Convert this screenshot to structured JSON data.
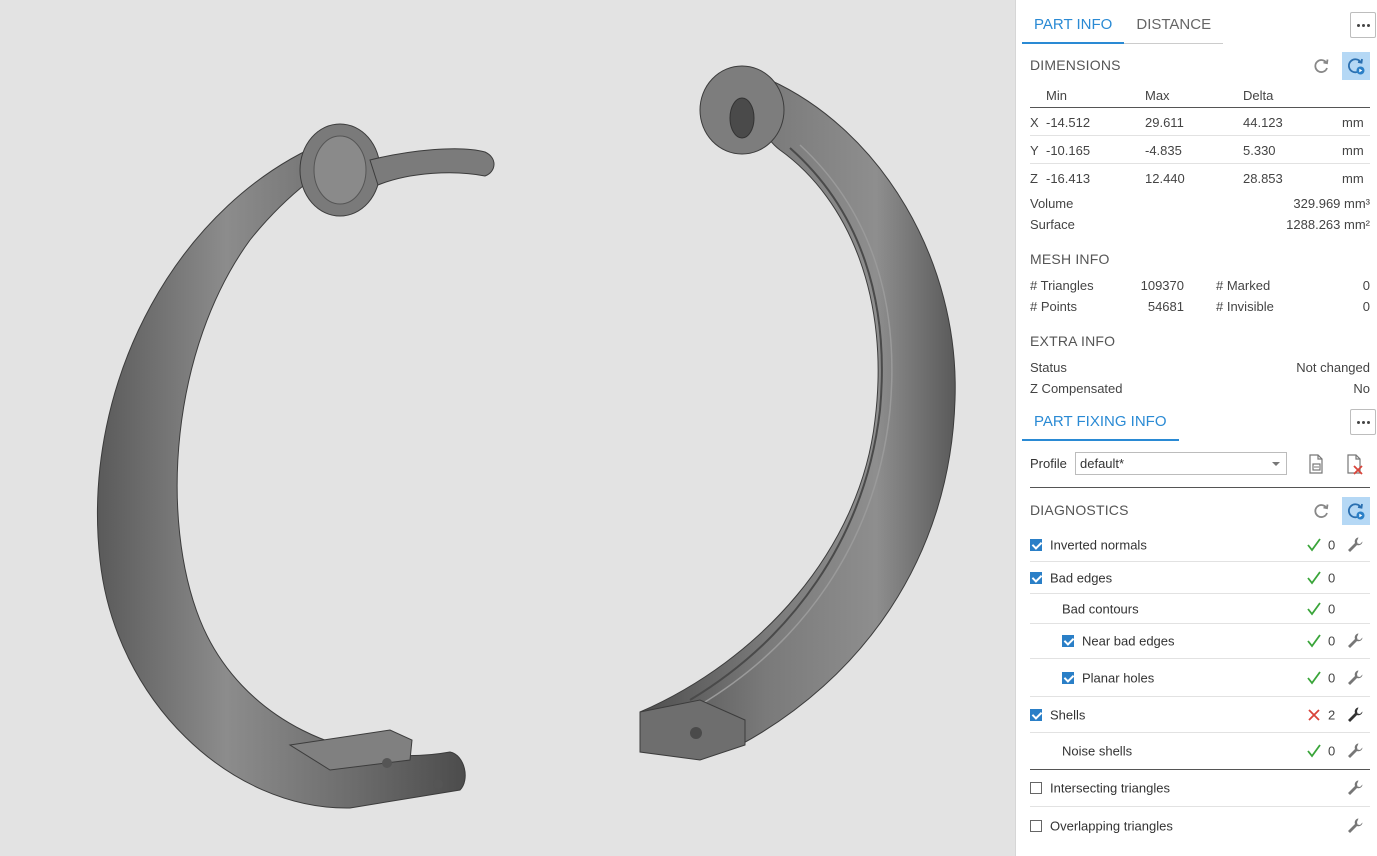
{
  "tabs": {
    "part_info": "PART INFO",
    "distance": "DISTANCE"
  },
  "dimensions": {
    "title": "DIMENSIONS",
    "headers": {
      "min": "Min",
      "max": "Max",
      "delta": "Delta"
    },
    "rows": [
      {
        "axis": "X",
        "min": "-14.512",
        "max": "29.611",
        "delta": "44.123",
        "unit": "mm"
      },
      {
        "axis": "Y",
        "min": "-10.165",
        "max": "-4.835",
        "delta": "5.330",
        "unit": "mm"
      },
      {
        "axis": "Z",
        "min": "-16.413",
        "max": "12.440",
        "delta": "28.853",
        "unit": "mm"
      }
    ],
    "volume_label": "Volume",
    "volume_value": "329.969  mm³",
    "surface_label": "Surface",
    "surface_value": "1288.263  mm²"
  },
  "mesh_info": {
    "title": "MESH INFO",
    "triangles_label": "# Triangles",
    "triangles_value": "109370",
    "points_label": "# Points",
    "points_value": "54681",
    "marked_label": "# Marked",
    "marked_value": "0",
    "invisible_label": "# Invisible",
    "invisible_value": "0"
  },
  "extra_info": {
    "title": "EXTRA INFO",
    "status_label": "Status",
    "status_value": "Not changed",
    "zcomp_label": "Z Compensated",
    "zcomp_value": "No"
  },
  "part_fixing": {
    "tab": "PART FIXING INFO",
    "profile_label": "Profile",
    "profile_value": "default*"
  },
  "diagnostics": {
    "title": "DIAGNOSTICS",
    "items": [
      {
        "label": "Inverted normals",
        "checked": true,
        "status": "ok",
        "count": "0",
        "wrench": true
      },
      {
        "label": "Bad edges",
        "checked": true,
        "status": "ok",
        "count": "0",
        "wrench": false
      },
      {
        "label": "Bad contours",
        "checked": null,
        "status": "ok",
        "count": "0",
        "wrench": false
      },
      {
        "label": "Near bad edges",
        "checked": true,
        "status": "ok",
        "count": "0",
        "wrench": true
      },
      {
        "label": "Planar holes",
        "checked": true,
        "status": "ok",
        "count": "0",
        "wrench": true
      },
      {
        "label": "Shells",
        "checked": true,
        "status": "error",
        "count": "2",
        "wrench": true
      },
      {
        "label": "Noise shells",
        "checked": null,
        "status": "ok",
        "count": "0",
        "wrench": true
      },
      {
        "label": "Intersecting triangles",
        "checked": false,
        "status": "",
        "count": "",
        "wrench": true
      },
      {
        "label": "Overlapping triangles",
        "checked": false,
        "status": "",
        "count": "",
        "wrench": true
      }
    ]
  },
  "colors": {
    "accent": "#2a8ad4",
    "ok": "#3aa53a",
    "error": "#d9443a",
    "selected_btn": "#b5d8f5"
  },
  "icons": [
    "more-icon",
    "refresh-icon",
    "auto-refresh-icon",
    "import-profile-icon",
    "delete-profile-icon",
    "check-icon",
    "cross-icon",
    "wrench-icon"
  ]
}
